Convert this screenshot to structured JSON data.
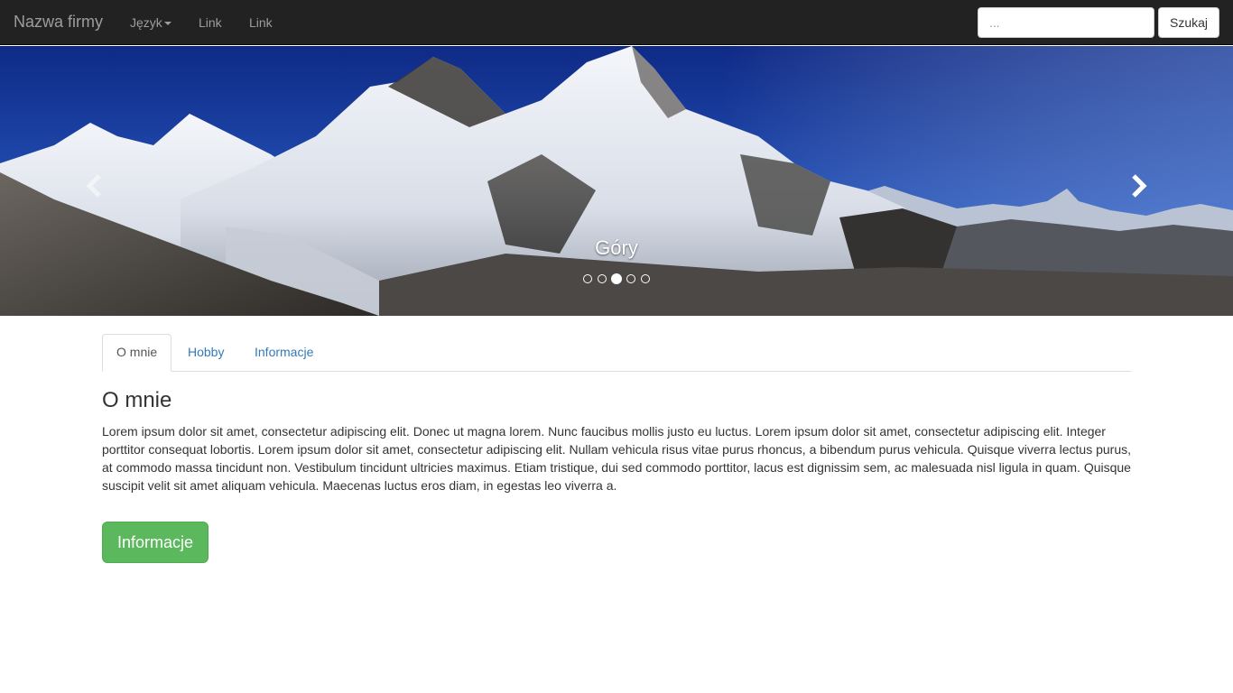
{
  "navbar": {
    "brand": "Nazwa firmy",
    "items": [
      {
        "label": "Język",
        "dropdown": true
      },
      {
        "label": "Link"
      },
      {
        "label": "Link"
      }
    ],
    "search": {
      "placeholder": "...",
      "value": ""
    },
    "search_button": "Szukaj"
  },
  "carousel": {
    "caption": "Góry",
    "slide_count": 5,
    "active_index": 2,
    "prev_icon": "chevron-left-icon",
    "next_icon": "chevron-right-icon"
  },
  "tabs": [
    {
      "label": "O mnie",
      "active": true
    },
    {
      "label": "Hobby",
      "active": false
    },
    {
      "label": "Informacje",
      "active": false
    }
  ],
  "content": {
    "heading": "O mnie",
    "paragraph": "Lorem ipsum dolor sit amet, consectetur adipiscing elit. Donec ut magna lorem. Nunc faucibus mollis justo eu luctus. Lorem ipsum dolor sit amet, consectetur adipiscing elit. Integer porttitor consequat lobortis. Lorem ipsum dolor sit amet, consectetur adipiscing elit. Nullam vehicula risus vitae purus rhoncus, a bibendum purus vehicula. Quisque viverra lectus purus, at commodo massa tincidunt non. Vestibulum tincidunt ultricies maximus. Etiam tristique, dui sed commodo porttitor, lacus est dignissim sem, ac malesuada nisl ligula in quam. Quisque suscipit velit sit amet aliquam vehicula. Maecenas luctus eros diam, in egestas leo viverra a.",
    "button": "Informacje"
  },
  "colors": {
    "navbar_bg": "#222222",
    "link": "#337ab7",
    "button_success": "#5cb85c"
  }
}
